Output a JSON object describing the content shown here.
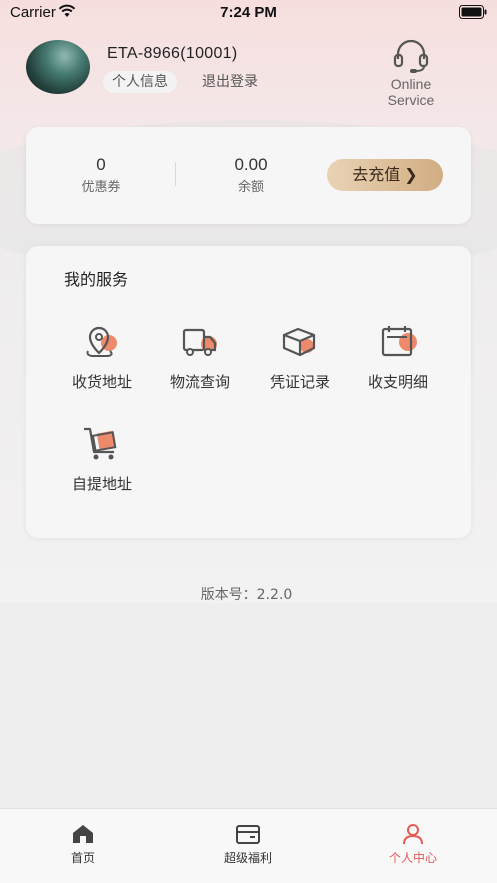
{
  "status_bar": {
    "carrier": "Carrier",
    "time": "7:24 PM"
  },
  "profile": {
    "username": "ETA-8966(10001)",
    "personal_info_label": "个人信息",
    "logout_label": "退出登录",
    "service_label_1": "Online",
    "service_label_2": "Service"
  },
  "wallet": {
    "coupon_value": "0",
    "coupon_label": "优惠券",
    "balance_value": "0.00",
    "balance_label": "余额",
    "recharge_label": "去充值"
  },
  "services": {
    "title": "我的服务",
    "items": [
      {
        "label": "收货地址",
        "icon": "location-icon"
      },
      {
        "label": "物流查询",
        "icon": "truck-icon"
      },
      {
        "label": "凭证记录",
        "icon": "box-icon"
      },
      {
        "label": "收支明细",
        "icon": "calendar-icon"
      },
      {
        "label": "自提地址",
        "icon": "cart-icon"
      }
    ]
  },
  "version": "版本号：2.2.0",
  "tabbar": {
    "items": [
      {
        "label": "首页",
        "icon": "home-icon"
      },
      {
        "label": "超级福利",
        "icon": "wallet-icon"
      },
      {
        "label": "个人中心",
        "icon": "user-icon",
        "active": true
      }
    ]
  },
  "colors": {
    "accent": "#e45b55",
    "icon_accent": "#ee8a6c",
    "recharge_start": "#e9d3b5",
    "recharge_end": "#d1ad82"
  }
}
